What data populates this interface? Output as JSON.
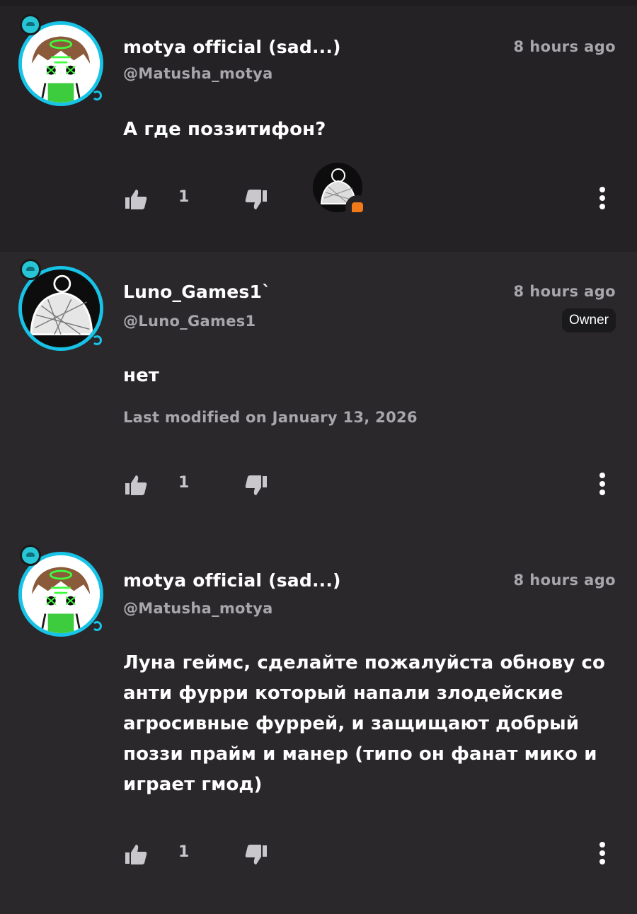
{
  "comments": [
    {
      "name": "motya official (sad...)",
      "handle": "@Matusha_motya",
      "time": "8 hours ago",
      "text": "А где поззитифон?",
      "likes": "1",
      "avatar_icon": "green-character-avatar",
      "has_reply_preview": true
    },
    {
      "name": "Luno_Games1`",
      "handle": "@Luno_Games1",
      "time": "8 hours ago",
      "badge": "Owner",
      "text": "нет",
      "modified": "Last modified on January 13, 2026",
      "likes": "1",
      "avatar_icon": "scribble-hat-avatar"
    },
    {
      "name": "motya official (sad...)",
      "handle": "@Matusha_motya",
      "time": "8 hours ago",
      "text": "Луна геймс, сделайте пожалуйста обнову со анти фурри который напали злодейские агросивные фуррей, и защищают добрый поззи прайм и манер (типо он фанат мико и играет гмод)",
      "likes": "1",
      "avatar_icon": "green-character-avatar"
    }
  ],
  "colors": {
    "background": "#2b282c",
    "highlight": "#242225",
    "avatar_ring": "#17c3e6",
    "reply_indicator": "#f07a1a"
  }
}
